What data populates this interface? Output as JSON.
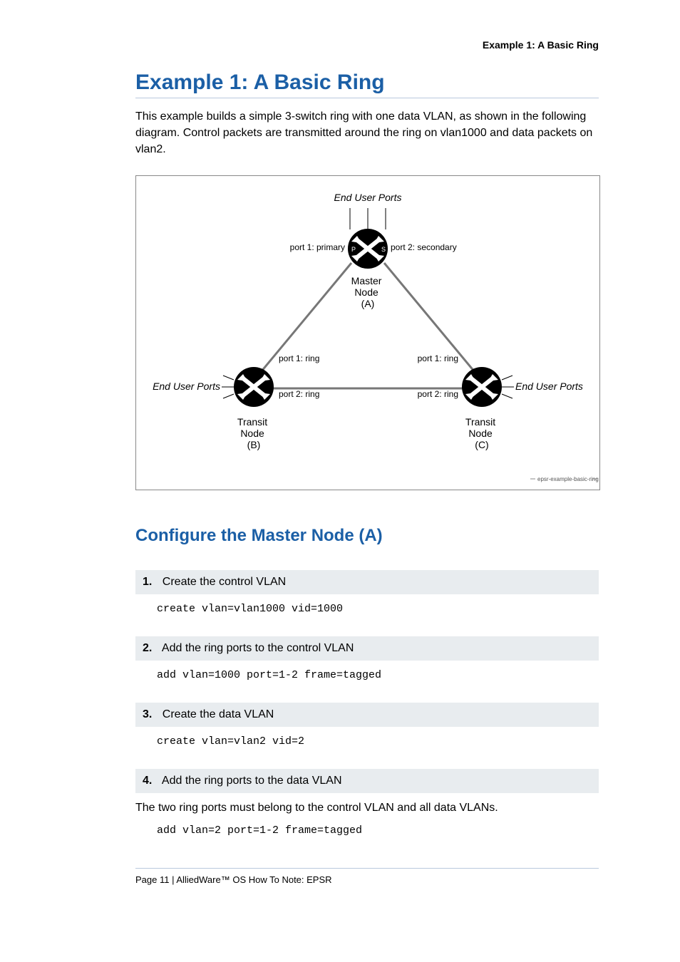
{
  "header": {
    "running": "Example 1: A Basic Ring"
  },
  "title": "Example 1: A Basic Ring",
  "intro": "This example builds a simple 3-switch ring with one data VLAN, as shown in the following diagram. Control packets are transmitted around the ring on vlan1000 and data packets on vlan2.",
  "diagram": {
    "top_label": "End User Ports",
    "port1_primary": "port 1: primary",
    "port2_secondary": "port 2: secondary",
    "master_node": "Master\nNode\n(A)",
    "port1_ring_L": "port 1: ring",
    "port1_ring_R": "port 1: ring",
    "port2_ring_L": "port 2: ring",
    "port2_ring_R": "port 2: ring",
    "end_user_L": "End User Ports",
    "end_user_R": "End User Ports",
    "transit_b": "Transit\nNode\n(B)",
    "transit_c": "Transit\nNode\n(C)",
    "tag": "epsr-example-basic-ring",
    "p_letter": "P",
    "s_letter": "S"
  },
  "section2": "Configure the Master Node (A)",
  "steps": [
    {
      "num": "1.",
      "title": "Create the control VLAN",
      "code": "create vlan=vlan1000 vid=1000"
    },
    {
      "num": "2.",
      "title": "Add the ring ports to the control VLAN",
      "code": "add vlan=1000 port=1-2 frame=tagged"
    },
    {
      "num": "3.",
      "title": "Create the data VLAN",
      "code": "create vlan=vlan2 vid=2"
    },
    {
      "num": "4.",
      "title": "Add the ring ports to the data VLAN",
      "code": "add vlan=2 port=1-2 frame=tagged"
    }
  ],
  "step4_note": "The two ring ports must belong to the control VLAN and all data VLANs.",
  "footer": "Page 11 | AlliedWare™ OS How To Note: EPSR"
}
